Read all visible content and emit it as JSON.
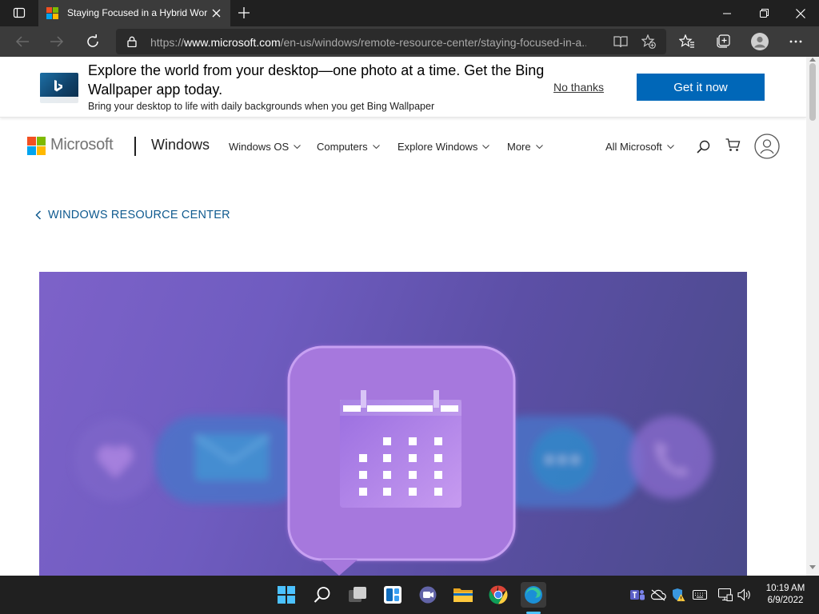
{
  "browser": {
    "tab_title": "Staying Focused in a Hybrid Wor",
    "url_prefix": "https://",
    "url_host": "www.microsoft.com",
    "url_path": "/en-us/windows/remote-resource-center/staying-focused-in-a..."
  },
  "banner": {
    "title": "Explore the world from your desktop—one photo at a time. Get the Bing Wallpaper app today.",
    "subtitle": "Bring your desktop to life with daily backgrounds when you get Bing Wallpaper",
    "dismiss_label": "No thanks",
    "cta_label": "Get it now"
  },
  "site_header": {
    "brand": "Microsoft",
    "product": "Windows",
    "nav": [
      "Windows OS",
      "Computers",
      "Explore Windows",
      "More"
    ],
    "all_microsoft": "All Microsoft"
  },
  "page": {
    "back_link": "WINDOWS RESOURCE CENTER"
  },
  "taskbar": {
    "time": "10:19 AM",
    "date": "6/9/2022"
  },
  "colors": {
    "accent": "#0067b8",
    "link": "#0f5a8f",
    "chrome_dark": "#202020",
    "hero_purple": "#6f5cc0"
  }
}
